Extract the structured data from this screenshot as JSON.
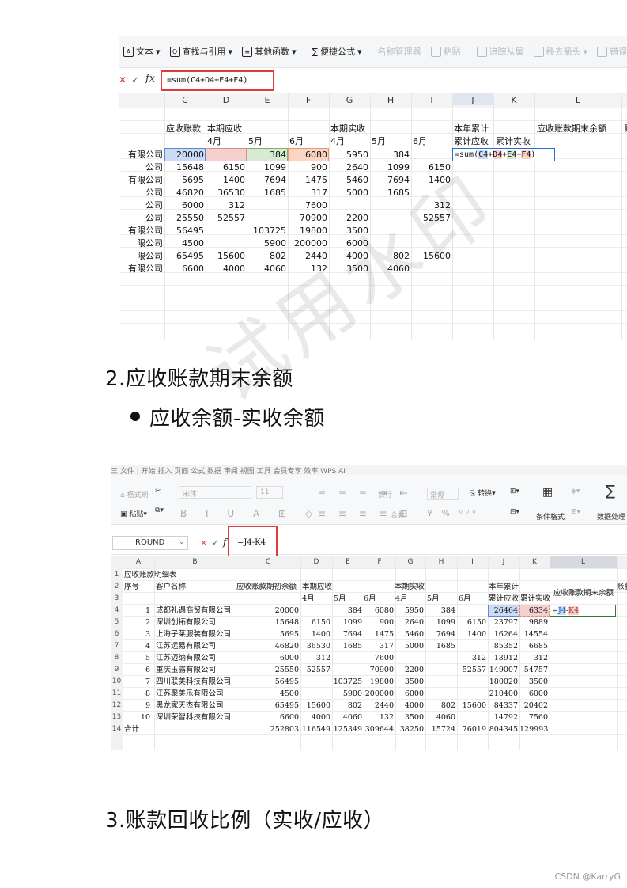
{
  "screenshot1": {
    "ribbon": [
      "文本",
      "查找与引用",
      "其他函数",
      "便捷公式",
      "名称管理器",
      "粘贴",
      "追踪从属",
      "移去箭头",
      "错误检"
    ],
    "formula_icons": {
      "cancel": "✕",
      "confirm": "✓",
      "fx": "fx"
    },
    "formula": "=sum(C4+D4+E4+F4)",
    "columns": [
      "C",
      "D",
      "E",
      "F",
      "G",
      "H",
      "I",
      "J",
      "K",
      "L"
    ],
    "header_row1": {
      "c": "应收账款",
      "d": "本期应收",
      "g": "本期实收",
      "j": "本年累计",
      "l": "应收账款期末余额",
      "m": "账"
    },
    "header_row2": {
      "d": "4月",
      "e": "5月",
      "f": "6月",
      "g": "4月",
      "h": "5月",
      "i": "6月",
      "j": "累计应收",
      "k": "累计实收"
    },
    "customers": [
      "有限公司",
      "公司",
      "有限公司",
      "公司",
      "公司",
      "公司",
      "有限公司",
      "限公司",
      "限公司",
      "有限公司"
    ],
    "rows": [
      [
        "20000",
        "",
        "384",
        "6080",
        "5950",
        "384",
        ""
      ],
      [
        "15648",
        "6150",
        "1099",
        "900",
        "2640",
        "1099",
        "6150"
      ],
      [
        "5695",
        "1400",
        "7694",
        "1475",
        "5460",
        "7694",
        "1400"
      ],
      [
        "46820",
        "36530",
        "1685",
        "317",
        "5000",
        "1685",
        ""
      ],
      [
        "6000",
        "312",
        "",
        "7600",
        "",
        "",
        "312"
      ],
      [
        "25550",
        "52557",
        "",
        "70900",
        "2200",
        "",
        "52557"
      ],
      [
        "56495",
        "",
        "103725",
        "19800",
        "3500",
        "",
        ""
      ],
      [
        "4500",
        "",
        "5900",
        "200000",
        "6000",
        "",
        ""
      ],
      [
        "65495",
        "15600",
        "802",
        "2440",
        "4000",
        "802",
        "15600"
      ],
      [
        "6600",
        "4000",
        "4060",
        "132",
        "3500",
        "4060",
        ""
      ]
    ],
    "cell_formula": {
      "prefix": "=sum(",
      "refs": [
        "C4",
        "D4",
        "E4",
        "F4"
      ],
      "ops": [
        "+",
        "+",
        "+"
      ],
      "suffix": ")"
    }
  },
  "heading2": "2.应收账款期末余额",
  "bullet": "应收余额-实收余额",
  "watermark": "试用水印",
  "screenshot2": {
    "menu": "三 文件  |  开始  插入  页面  公式  数据  审阅  视图  工具  会员专享  效率  WPS AI",
    "ribbon": {
      "format_painter": "格式刷",
      "paste": "粘贴",
      "font": "宋体",
      "size": "11",
      "number_format": "常规",
      "convert": "转换",
      "wrap": "换行",
      "merge": "合并",
      "cond_format": "条件格式",
      "data_proc": "数据处理"
    },
    "namebox": "ROUND",
    "formula": "=J4-K4",
    "columns": [
      "A",
      "B",
      "C",
      "D",
      "E",
      "F",
      "G",
      "H",
      "I",
      "J",
      "K",
      "L"
    ],
    "title": "应收账款明细表",
    "hdr": {
      "seq": "序号",
      "name": "客户名称",
      "opening": "应收账款期初余额",
      "recv": "本期应收",
      "paid": "本期实收",
      "ytd": "本年累计",
      "end": "应收账款期末余额",
      "trunc": "账款"
    },
    "months": [
      "4月",
      "5月",
      "6月",
      "4月",
      "5月",
      "6月"
    ],
    "ytd_sub": [
      "累计应收",
      "累计实收"
    ],
    "rows": [
      [
        "1",
        "成都礼遇商贸有限公司",
        "20000",
        "",
        "384",
        "6080",
        "5950",
        "384",
        "",
        "26464",
        "6334"
      ],
      [
        "2",
        "深圳创拓有限公司",
        "15648",
        "6150",
        "1099",
        "900",
        "2640",
        "1099",
        "6150",
        "23797",
        "9889"
      ],
      [
        "3",
        "上海子莱服装有限公司",
        "5695",
        "1400",
        "7694",
        "1475",
        "5460",
        "7694",
        "1400",
        "16264",
        "14554"
      ],
      [
        "4",
        "江苏远易有限公司",
        "46820",
        "36530",
        "1685",
        "317",
        "5000",
        "1685",
        "",
        "85352",
        "6685"
      ],
      [
        "5",
        "江苏迈纳有限公司",
        "6000",
        "312",
        "",
        "7600",
        "",
        "",
        "312",
        "13912",
        "312"
      ],
      [
        "6",
        "重庆玉露有限公司",
        "25550",
        "52557",
        "",
        "70900",
        "2200",
        "",
        "52557",
        "149007",
        "54757"
      ],
      [
        "7",
        "四川联美科技有限公司",
        "56495",
        "",
        "103725",
        "19800",
        "3500",
        "",
        "",
        "180020",
        "3500"
      ],
      [
        "8",
        "江苏聚美乐有限公司",
        "4500",
        "",
        "5900",
        "200000",
        "6000",
        "",
        "",
        "210400",
        "6000"
      ],
      [
        "9",
        "黑龙家天杰有限公司",
        "65495",
        "15600",
        "802",
        "2440",
        "4000",
        "802",
        "15600",
        "84337",
        "20402"
      ],
      [
        "10",
        "深圳荣智科技有限公司",
        "6600",
        "4000",
        "4060",
        "132",
        "3500",
        "4060",
        "",
        "14792",
        "7560"
      ]
    ],
    "total": [
      "合计",
      "252803",
      "116549",
      "125349",
      "309644",
      "38250",
      "15724",
      "76019",
      "804345",
      "129993"
    ],
    "cell_formula": {
      "eq": "=",
      "ref1": "J4",
      "op": "-",
      "ref2": "K4"
    },
    "row_numbers": [
      "1",
      "2",
      "3",
      "4",
      "5",
      "6",
      "7",
      "8",
      "9",
      "10",
      "11",
      "12",
      "13",
      "14"
    ]
  },
  "heading3": "3.账款回收比例（实收/应收）",
  "footer": "CSDN @KarryG",
  "colors": {
    "blue_ref": "#c9dbf5",
    "red_ref": "#f6cfcf",
    "green_ref": "#d9ead3",
    "orange_ref": "#fbd5c4",
    "highlight_box": "#e23a3a"
  }
}
